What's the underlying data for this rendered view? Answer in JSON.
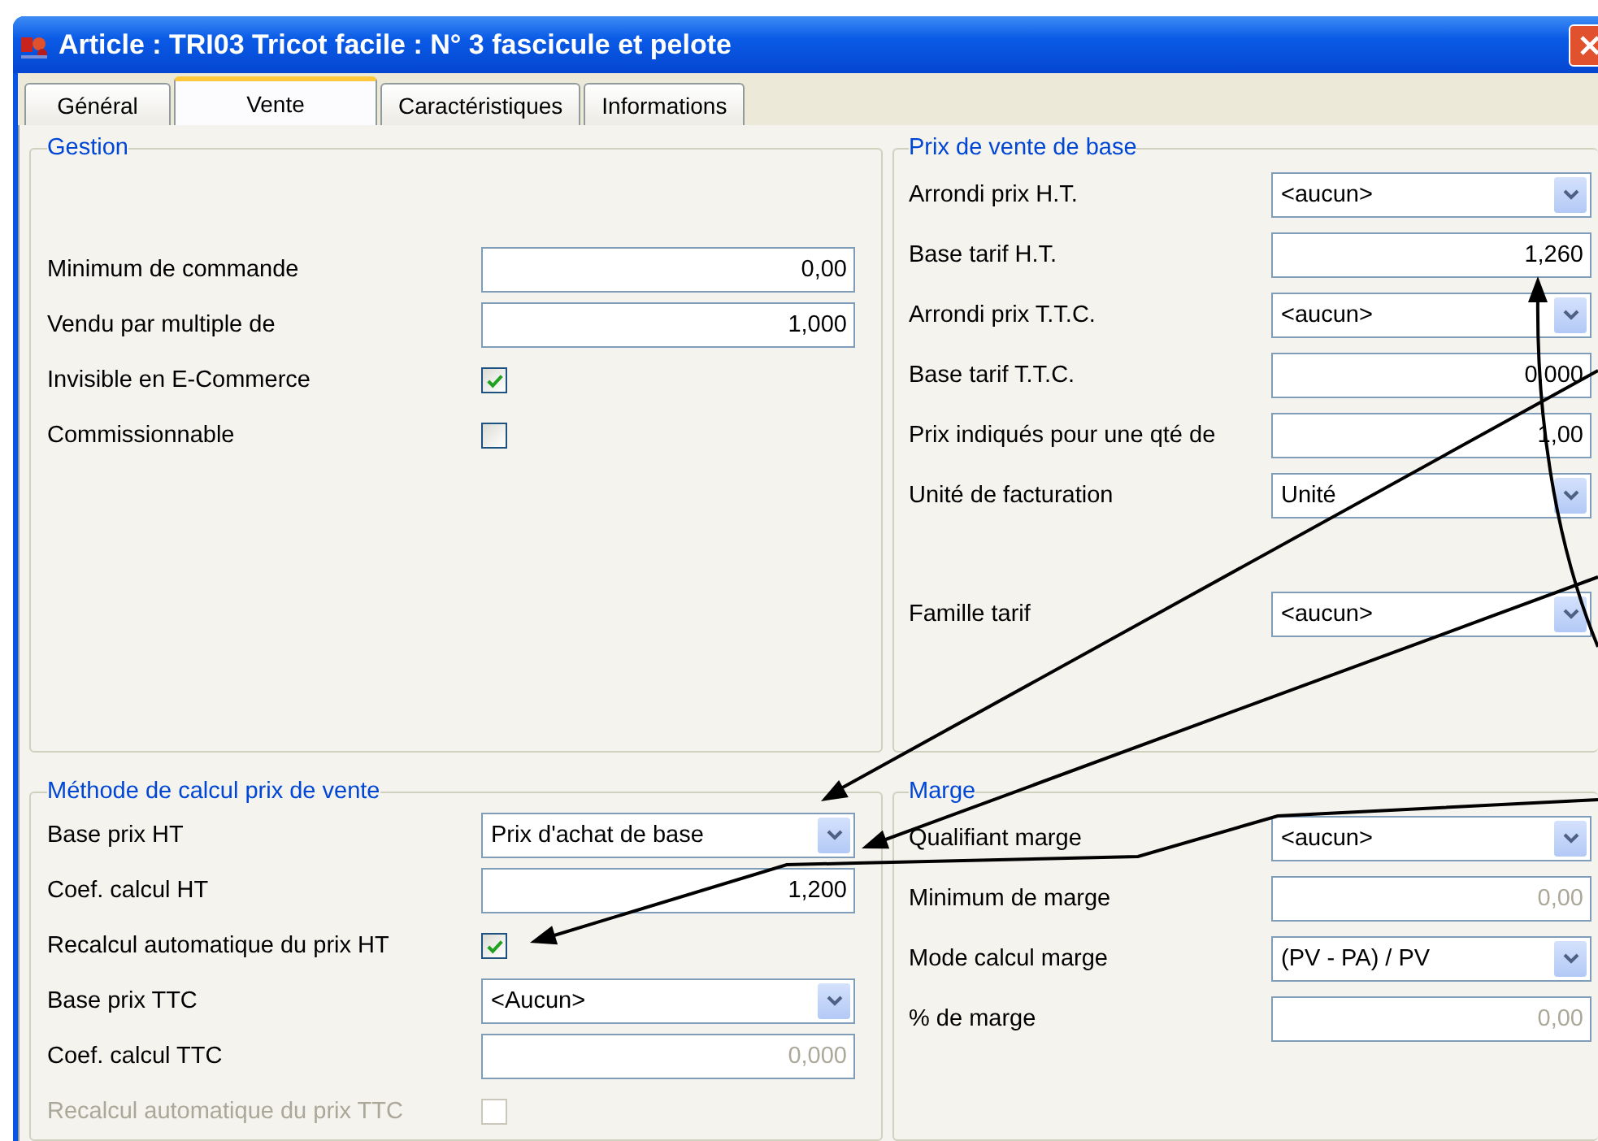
{
  "window": {
    "title": "Article  : TRI03 Tricot facile : N° 3 fascicule et pelote"
  },
  "tabs": [
    {
      "label": "Général",
      "selected": false
    },
    {
      "label": "Vente",
      "selected": true
    },
    {
      "label": "Caractéristiques",
      "selected": false
    },
    {
      "label": "Informations",
      "selected": false
    }
  ],
  "groups": [
    {
      "title": "Gestion",
      "rows": [
        {
          "kind": "text",
          "label": "Minimum de commande",
          "value": "0,00",
          "disabled": false
        },
        {
          "kind": "text",
          "label": "Vendu par multiple de",
          "value": "1,000",
          "disabled": false
        },
        {
          "kind": "check",
          "label": "Invisible en E-Commerce",
          "checked": true,
          "disabled": false
        },
        {
          "kind": "check",
          "label": "Commissionnable",
          "checked": false,
          "disabled": false
        }
      ]
    },
    {
      "title": "Prix de vente de base",
      "rows": [
        {
          "kind": "combo",
          "label": "Arrondi prix H.T.",
          "value": "<aucun>"
        },
        {
          "kind": "text",
          "label": "Base tarif H.T.",
          "value": "1,260",
          "disabled": false
        },
        {
          "kind": "combo",
          "label": "Arrondi prix T.T.C.",
          "value": "<aucun>"
        },
        {
          "kind": "text",
          "label": "Base tarif T.T.C.",
          "value": "0,000",
          "disabled": false
        },
        {
          "kind": "text",
          "label": "Prix indiqués pour une qté de",
          "value": "1,00",
          "disabled": false
        },
        {
          "kind": "combo",
          "label": "Unité de facturation",
          "value": "Unité"
        },
        {
          "kind": "combo",
          "label": "Famille tarif",
          "value": "<aucun>"
        }
      ]
    },
    {
      "title": "Méthode de calcul prix de vente",
      "rows": [
        {
          "kind": "combo",
          "label": "Base prix HT",
          "value": "Prix d'achat de base"
        },
        {
          "kind": "text",
          "label": "Coef. calcul HT",
          "value": "1,200",
          "disabled": false
        },
        {
          "kind": "check",
          "label": "Recalcul automatique du prix HT",
          "checked": true,
          "disabled": false
        },
        {
          "kind": "combo",
          "label": "Base prix TTC",
          "value": "<Aucun>"
        },
        {
          "kind": "text",
          "label": "Coef. calcul TTC",
          "value": "0,000",
          "disabled": true
        },
        {
          "kind": "check",
          "label": "Recalcul automatique du prix TTC",
          "checked": false,
          "disabled": true
        }
      ]
    },
    {
      "title": "Marge",
      "rows": [
        {
          "kind": "combo",
          "label": "Qualifiant marge",
          "value": "<aucun>"
        },
        {
          "kind": "text",
          "label": "Minimum de marge",
          "value": "0,00",
          "disabled": true
        },
        {
          "kind": "combo",
          "label": "Mode calcul marge",
          "value": "(PV - PA) /  PV"
        },
        {
          "kind": "text",
          "label": "% de marge",
          "value": "0,00",
          "disabled": true
        }
      ]
    }
  ]
}
